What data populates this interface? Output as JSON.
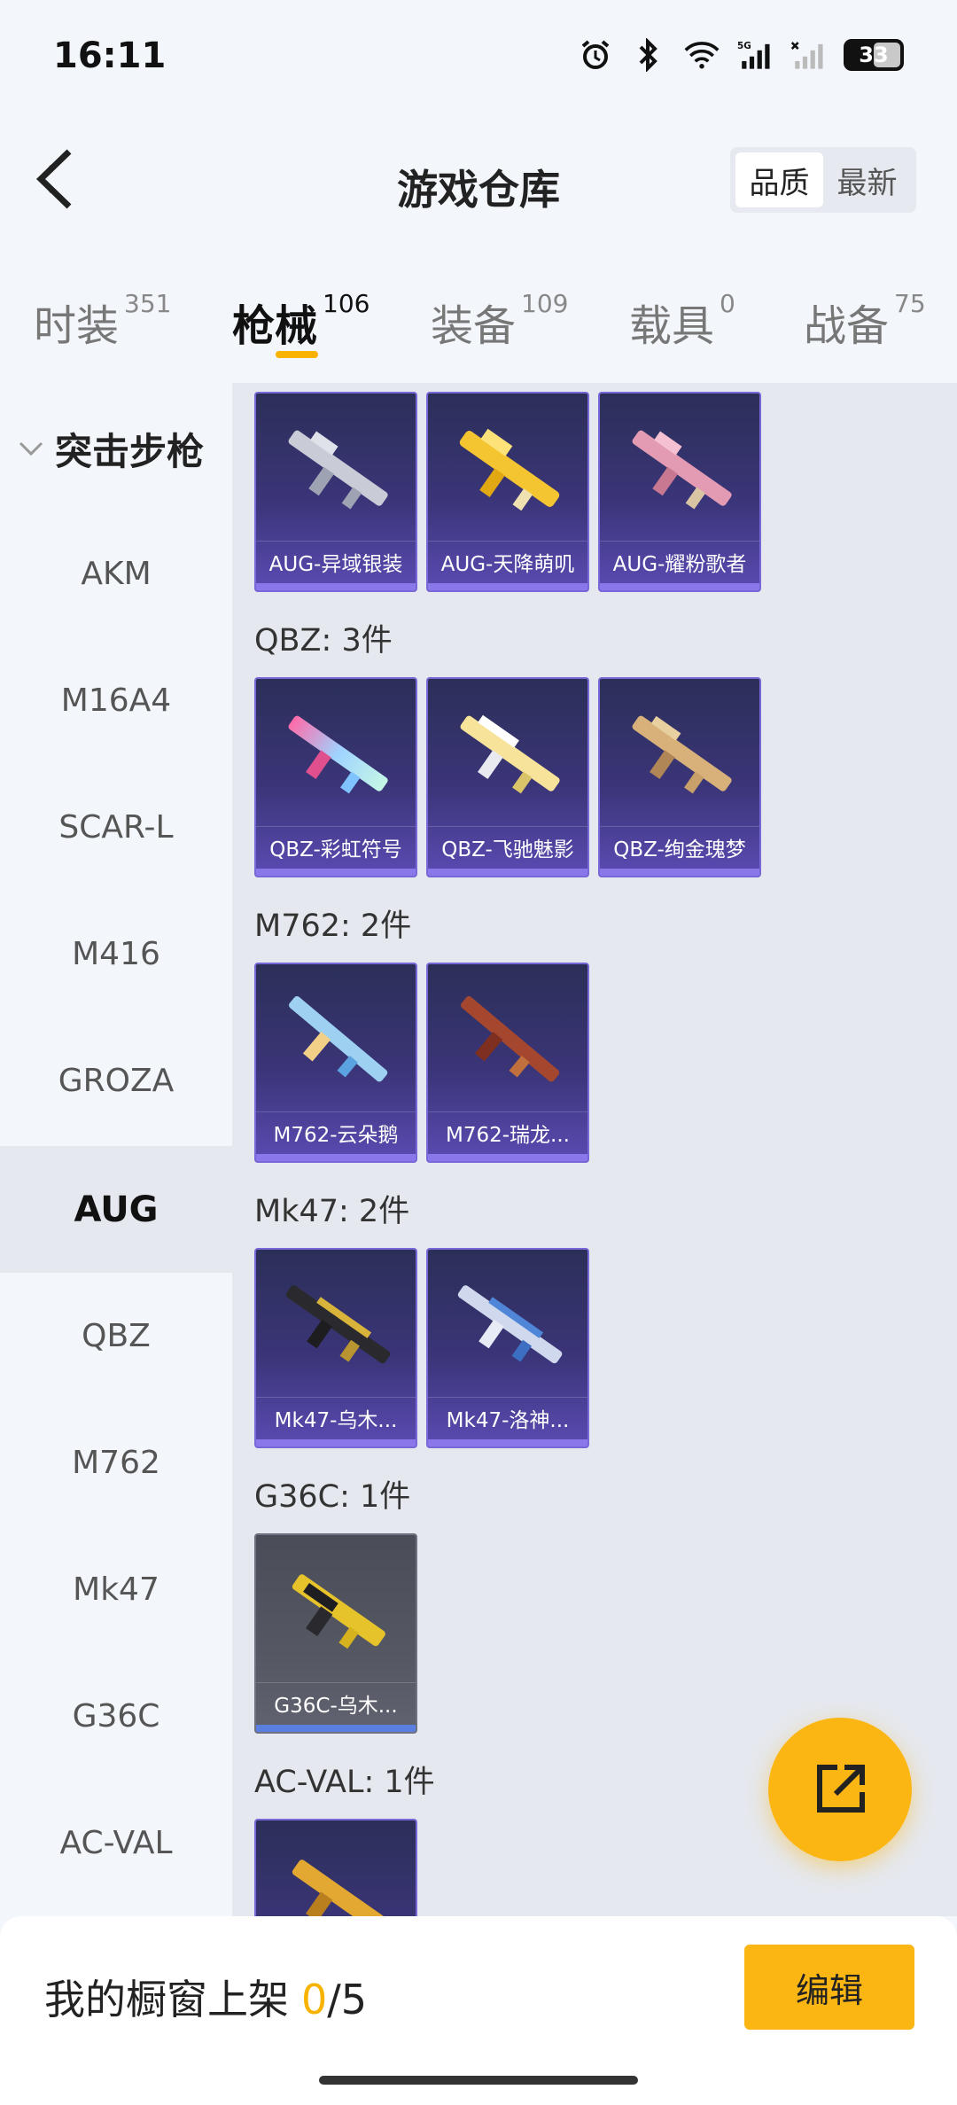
{
  "status": {
    "time": "16:11",
    "battery": "33",
    "network": "5G"
  },
  "header": {
    "title": "游戏仓库",
    "sort_options": [
      "品质",
      "最新"
    ],
    "active_sort": "品质"
  },
  "tabs": [
    {
      "label": "时装",
      "count": "351"
    },
    {
      "label": "枪械",
      "count": "106"
    },
    {
      "label": "装备",
      "count": "109"
    },
    {
      "label": "载具",
      "count": "0"
    },
    {
      "label": "战备",
      "count": "75"
    }
  ],
  "active_tab": "枪械",
  "sidebar": {
    "group": "突击步枪",
    "items": [
      "AKM",
      "M16A4",
      "SCAR-L",
      "M416",
      "GROZA",
      "AUG",
      "QBZ",
      "M762",
      "Mk47",
      "G36C",
      "AC-VAL"
    ],
    "active": "AUG"
  },
  "content": {
    "aug_cards": [
      "AUG-异域银装",
      "AUG-天降萌叽",
      "AUG-耀粉歌者"
    ],
    "qbz_title": "QBZ: 3件",
    "qbz_cards": [
      "QBZ-彩虹符号",
      "QBZ-飞驰魅影",
      "QBZ-绚金瑰梦"
    ],
    "m762_title": "M762: 2件",
    "m762_cards": [
      "M762-云朵鹅",
      "M762-瑞龙..."
    ],
    "mk47_title": "Mk47: 2件",
    "mk47_cards": [
      "Mk47-乌木...",
      "Mk47-洛神..."
    ],
    "g36c_title": "G36C: 1件",
    "g36c_cards": [
      "G36C-乌木..."
    ],
    "acval_title": "AC-VAL: 1件"
  },
  "bottom": {
    "showcase_label": "我的橱窗上架",
    "showcase_current": "0",
    "showcase_total": "/5",
    "edit_label": "编辑"
  },
  "colors": {
    "accent": "#fcb614",
    "card_purple": "#3b3579",
    "card_grey": "#555862"
  },
  "icons": {
    "back": "chevron-left-icon",
    "fab": "share-external-icon",
    "group": "chevron-down-icon"
  }
}
